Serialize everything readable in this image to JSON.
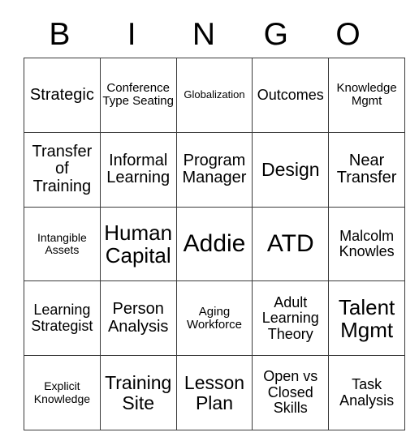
{
  "header": {
    "letters": [
      "B",
      "I",
      "N",
      "G",
      "O"
    ]
  },
  "grid": {
    "rows": [
      [
        {
          "label": "Strategic",
          "size": "fs-lg"
        },
        {
          "label": "Conference Type Seating",
          "size": "fs-smm"
        },
        {
          "label": "Globalization",
          "size": "fs-xs"
        },
        {
          "label": "Outcomes",
          "size": "fs-md"
        },
        {
          "label": "Knowledge Mgmt",
          "size": "fs-smm"
        }
      ],
      [
        {
          "label": "Transfer of Training",
          "size": "fs-lg"
        },
        {
          "label": "Informal Learning",
          "size": "fs-lg"
        },
        {
          "label": "Program Manager",
          "size": "fs-lg"
        },
        {
          "label": "Design",
          "size": "fs-xl"
        },
        {
          "label": "Near Transfer",
          "size": "fs-lg"
        }
      ],
      [
        {
          "label": "Intangible Assets",
          "size": "fs-sm"
        },
        {
          "label": "Human Capital",
          "size": "fs-xxl"
        },
        {
          "label": "Addie",
          "size": "fs-h"
        },
        {
          "label": "ATD",
          "size": "fs-h"
        },
        {
          "label": "Malcolm Knowles",
          "size": "fs-md"
        }
      ],
      [
        {
          "label": "Learning Strategist",
          "size": "fs-md"
        },
        {
          "label": "Person Analysis",
          "size": "fs-lg"
        },
        {
          "label": "Aging Workforce",
          "size": "fs-smm"
        },
        {
          "label": "Adult Learning Theory",
          "size": "fs-md"
        },
        {
          "label": "Talent Mgmt",
          "size": "fs-xxl"
        }
      ],
      [
        {
          "label": "Explicit Knowledge",
          "size": "fs-sm"
        },
        {
          "label": "Training Site",
          "size": "fs-xl"
        },
        {
          "label": "Lesson Plan",
          "size": "fs-xl"
        },
        {
          "label": "Open vs Closed Skills",
          "size": "fs-md"
        },
        {
          "label": "Task Analysis",
          "size": "fs-md"
        }
      ]
    ]
  },
  "colors": {
    "border": "#3a3a3a",
    "text": "#000000",
    "background": "#ffffff"
  }
}
